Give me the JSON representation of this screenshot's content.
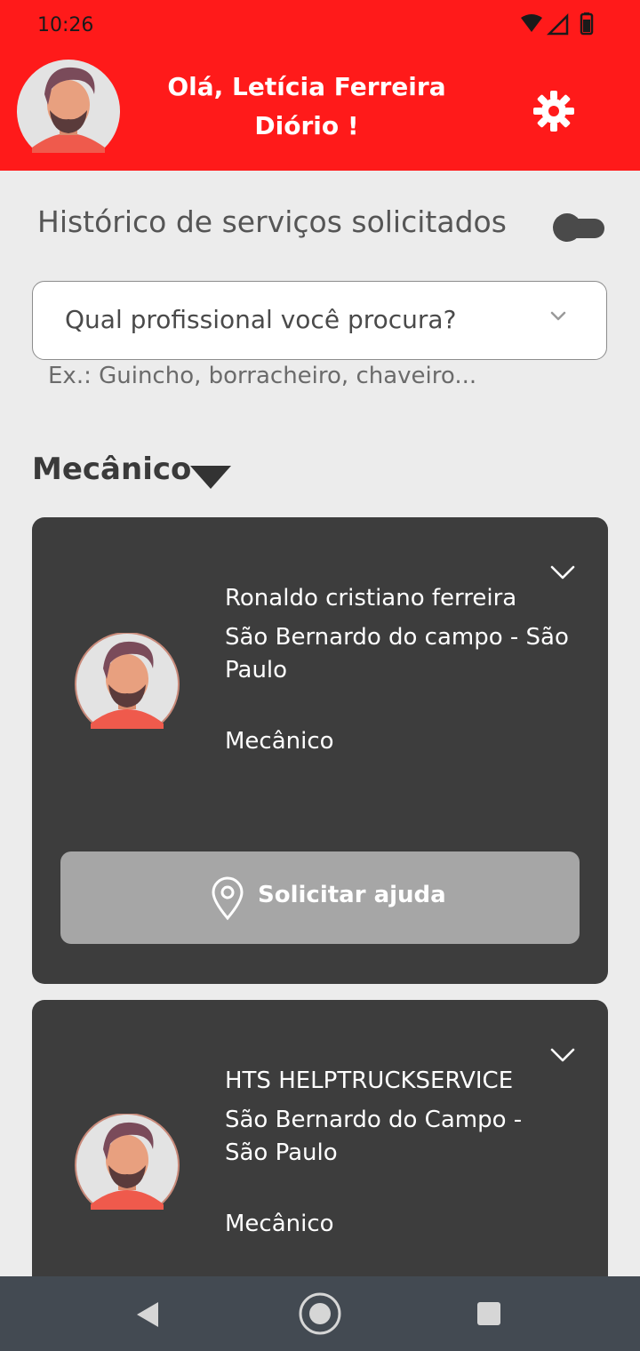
{
  "status_bar": {
    "time": "10:26"
  },
  "header": {
    "greeting_line1": "Olá, Letícia Ferreira",
    "greeting_line2": "Diório !",
    "color": "#ff1a1a"
  },
  "history": {
    "label": "Histórico de serviços solicitados",
    "toggle_on": false
  },
  "search": {
    "placeholder": "Qual profissional você procura?",
    "helper": "Ex.: Guincho, borracheiro, chaveiro..."
  },
  "section": {
    "title": "Mecânico"
  },
  "cards": [
    {
      "name": "Ronaldo cristiano ferreira",
      "location": "São Bernardo do campo  - São Paulo",
      "category": "Mecânico",
      "button_label": "Solicitar ajuda"
    },
    {
      "name": "HTS HELPTRUCKSERVICE",
      "location": "São Bernardo do Campo  - São Paulo",
      "category": "Mecânico"
    }
  ],
  "icons": {
    "settings": "gear-icon",
    "location": "map-pin-icon",
    "expand": "chevron-down-icon"
  }
}
